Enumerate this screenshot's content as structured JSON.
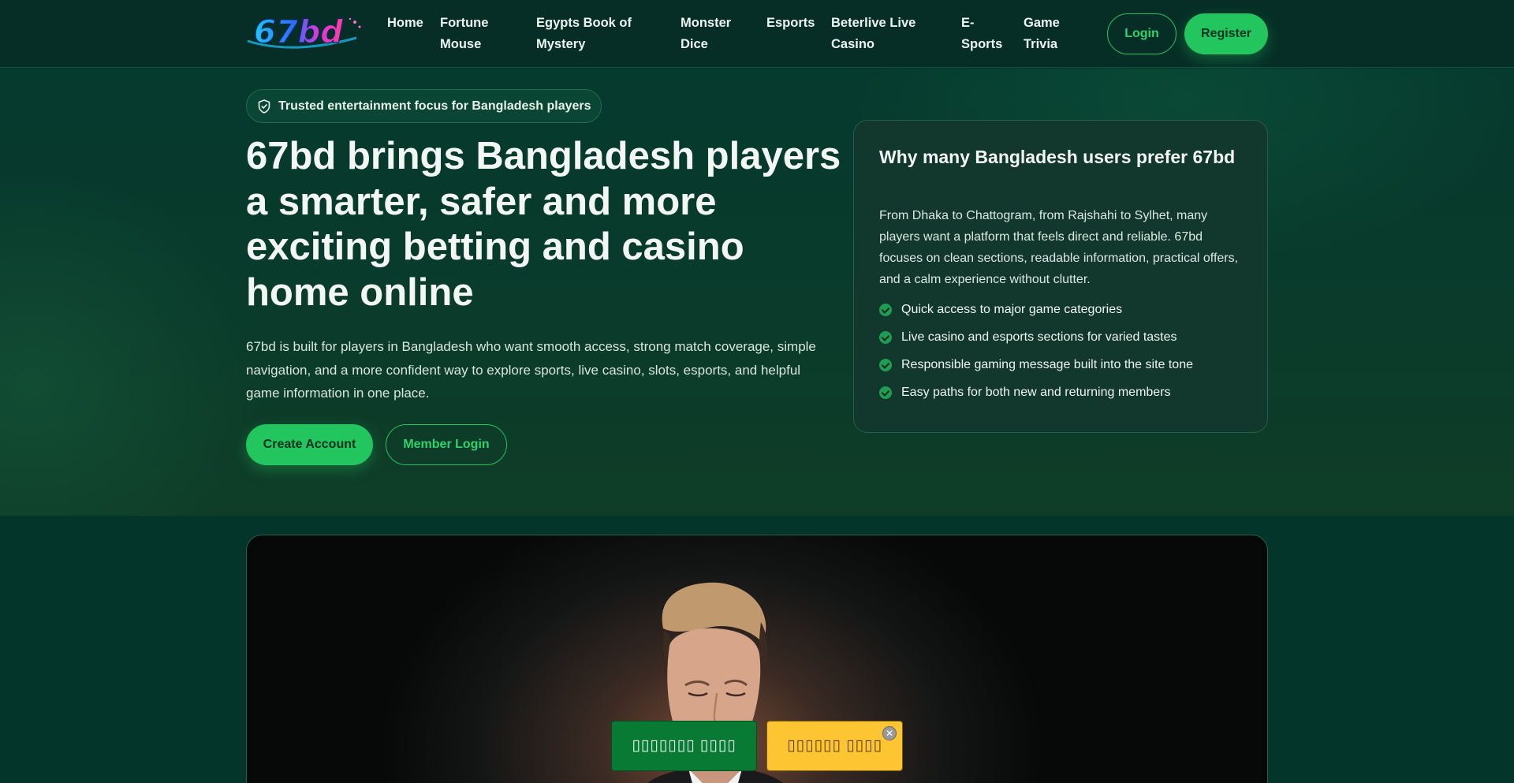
{
  "header": {
    "logo_text": "67bd",
    "nav": [
      {
        "label": "Home"
      },
      {
        "label": "Fortune Mouse"
      },
      {
        "label": "Egypts Book of Mystery"
      },
      {
        "label": "Monster Dice"
      },
      {
        "label": "Esports"
      },
      {
        "label": "Beterlive Live Casino"
      },
      {
        "label": "E-Sports"
      },
      {
        "label": "Game Trivia"
      }
    ],
    "login_label": "Login",
    "register_label": "Register"
  },
  "hero": {
    "badge_icon": "shield-check-icon",
    "badge_text": "Trusted entertainment focus for Bangladesh players",
    "title": "67bd brings Bangladesh players a smarter, safer and more exciting betting and casino home online",
    "description": "67bd is built for players in Bangladesh who want smooth access, strong match coverage, simple navigation, and a more confident way to explore sports, live casino, slots, esports, and helpful game information in one place.",
    "create_label": "Create Account",
    "member_label": "Member Login"
  },
  "card": {
    "title": "Why many Bangladesh users prefer 67bd",
    "text": "From Dhaka to Chattogram, from Rajshahi to Sylhet, many players want a platform that feels direct and reliable. 67bd focuses on clean sections, readable information, practical offers, and a calm experience without clutter.",
    "items": [
      {
        "label": "Quick access to major game categories"
      },
      {
        "label": "Live casino and esports sections for varied tastes"
      },
      {
        "label": "Responsible gaming message built into the site tone"
      },
      {
        "label": "Easy paths for both new and returning members"
      }
    ],
    "check_icon": "check-circle-icon"
  },
  "floating_bar": {
    "green_label": "▯▯▯▯▯▯▯ ▯▯▯▯",
    "yellow_label": "▯▯▯▯▯▯ ▯▯▯▯",
    "close_icon": "close-icon",
    "close_glyph": "✕"
  },
  "colors": {
    "accent": "#22c55e",
    "background": "#04352b",
    "card": "#12382d",
    "float_green": "#087a34",
    "float_yellow": "#fdc531"
  }
}
